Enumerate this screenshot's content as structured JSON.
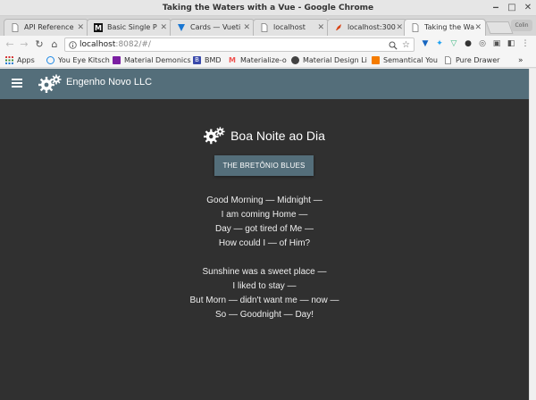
{
  "window": {
    "title": "Taking the Waters with a Vue - Google Chrome"
  },
  "tabs": [
    {
      "label": "API Reference"
    },
    {
      "label": "Basic Single P"
    },
    {
      "label": "Cards — Vueti"
    },
    {
      "label": "localhost"
    },
    {
      "label": "localhost:300"
    },
    {
      "label": "Taking the Wa"
    }
  ],
  "profile": {
    "label": "Colin"
  },
  "address_bar": {
    "host": "localhost",
    "rest": ":8082/#/"
  },
  "bookmarks": [
    {
      "label": "Apps",
      "color": "#4a90d9"
    },
    {
      "label": "You Eye Kitsch",
      "color": "#1e88e5"
    },
    {
      "label": "Material Demonics",
      "color": "#7b1fa2"
    },
    {
      "label": "BMD",
      "color": "#3949ab"
    },
    {
      "label": "Materialize-o",
      "color": "#ef5350"
    },
    {
      "label": "Material Design Li",
      "color": "#424242"
    },
    {
      "label": "Semantical You",
      "color": "#f57c00"
    },
    {
      "label": "Pure Drawer",
      "color": "#9e9e9e"
    }
  ],
  "app": {
    "title": "Engenho Novo LLC",
    "heading": "Boa Noite ao Dia",
    "button": "THE BRETÔNIO BLUES",
    "accent": "#546e7a",
    "background": "#303030",
    "stanzas": [
      [
        "Good Morning — Midnight —",
        "I am coming Home —",
        "Day — got tired of Me —",
        "How could I — of Him?"
      ],
      [
        "Sunshine was a sweet place —",
        "I liked to stay —",
        "But Morn — didn't want me — now —",
        "So — Goodnight — Day!"
      ]
    ]
  }
}
